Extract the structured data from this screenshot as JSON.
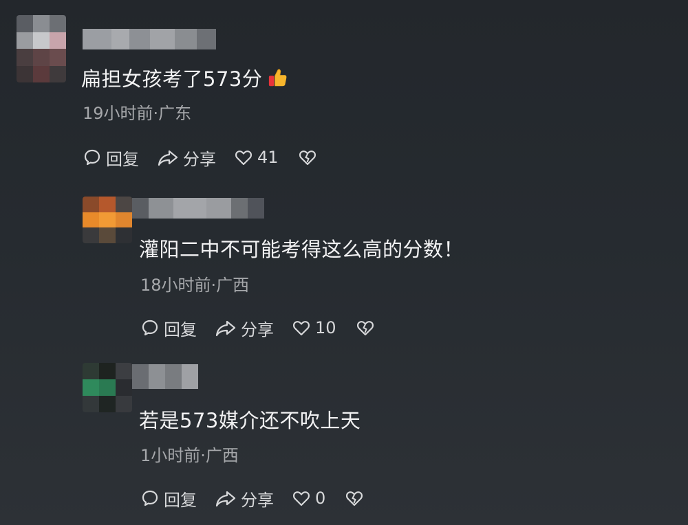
{
  "comments": [
    {
      "content": "扁担女孩考了573分",
      "meta": "19小时前·广东",
      "reply_label": "回复",
      "share_label": "分享",
      "likes": "41",
      "emoji": "thumbs-up"
    },
    {
      "content": "灌阳二中不可能考得这么高的分数！",
      "meta": "18小时前·广西",
      "reply_label": "回复",
      "share_label": "分享",
      "likes": "10"
    },
    {
      "content": "若是573媒介还不吹上天",
      "meta": "1小时前·广西",
      "reply_label": "回复",
      "share_label": "分享",
      "likes": "0"
    }
  ],
  "icons": {
    "reply": "comment-bubble-icon",
    "share": "share-arrow-icon",
    "like": "heart-icon",
    "dislike": "broken-heart-icon"
  }
}
